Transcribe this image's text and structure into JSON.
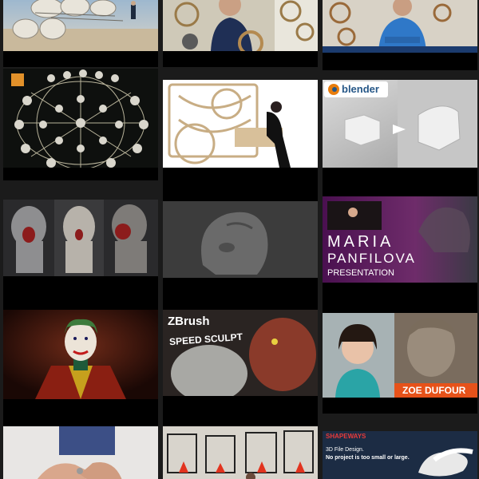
{
  "page": {
    "background": "#1b1b1b",
    "card_background": "#000000"
  },
  "thumbnails": [
    {
      "id": "strandbeest",
      "alt": "kinetic beach sculpture"
    },
    {
      "id": "woodworker-gears",
      "alt": "man with wooden gear mechanism"
    },
    {
      "id": "man-arms-crossed",
      "alt": "man in blue sweater with arms crossed"
    },
    {
      "id": "sphere-sculpture",
      "alt": "metal sphere kinetic sculpture"
    },
    {
      "id": "marble-machine",
      "alt": "wooden marble machine with player"
    },
    {
      "id": "blender-tutorial",
      "alt": "Blender modeling tutorial",
      "brand_text": "blender",
      "brand_color": "#e87d0d"
    },
    {
      "id": "helmet-heads",
      "alt": "sci-fi helmet sculpts"
    },
    {
      "id": "gray-helmet",
      "alt": "gray sculpted helmet bust"
    },
    {
      "id": "maria-panfilova",
      "alt": "presentation title card",
      "title_line1": "MARIA",
      "title_line2": "PANFILOVA",
      "subtitle": "PRESENTATION"
    },
    {
      "id": "joker-portrait",
      "alt": "joker digital painting"
    },
    {
      "id": "zbrush-speed-sculpt",
      "alt": "ZBrush speed sculpt thumbnail",
      "brand_text": "ZBrush",
      "headline": "SPEED SCULPT"
    },
    {
      "id": "zoe-dufour",
      "alt": "woman with clay bust",
      "name_tag": "ZOE DUFOUR"
    },
    {
      "id": "hands-crafting",
      "alt": "hands working on small object"
    },
    {
      "id": "3d-printers",
      "alt": "row of 3D printers"
    },
    {
      "id": "shapeways",
      "alt": "Shapeways ad",
      "brand_text": "SHAPEWAYS",
      "headline_line1": "3D File Design.",
      "headline_line2": "No project is too small or large."
    }
  ]
}
